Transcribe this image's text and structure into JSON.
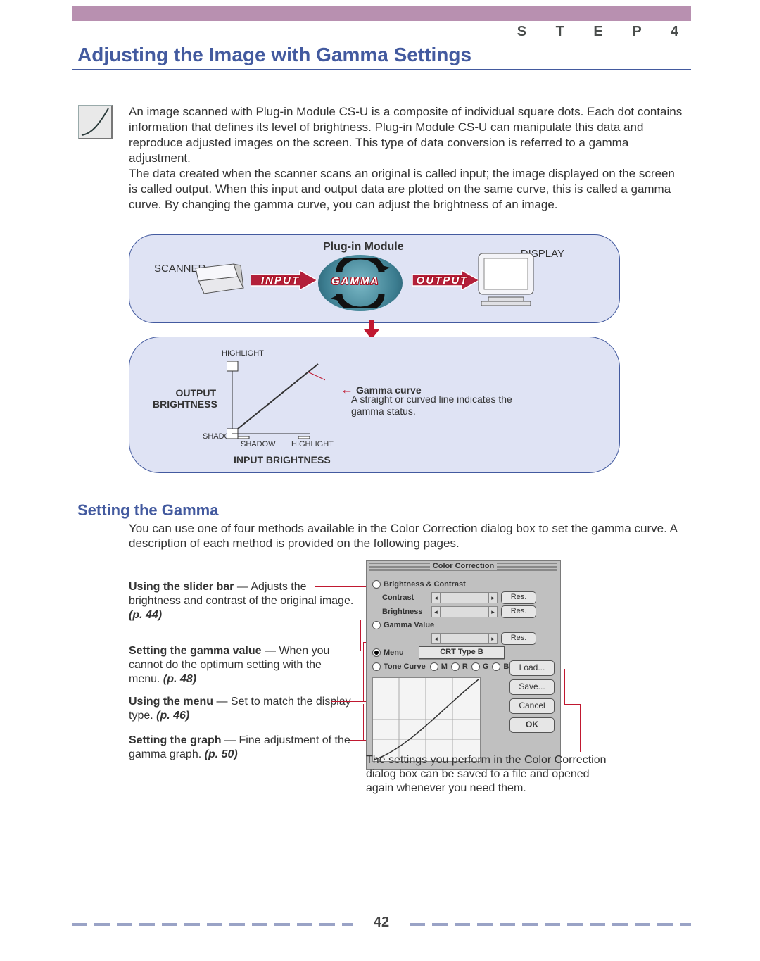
{
  "header": {
    "step": "S T E P   4",
    "title": "Adjusting the Image with Gamma Settings"
  },
  "intro": "An image scanned with Plug-in Module CS-U is a composite of individual square dots. Each dot contains information that defines its level of brightness.  Plug-in Module CS-U can manipulate this data and reproduce adjusted images on the screen.  This type of data conversion is referred to a gamma adjustment.\nThe data created when the scanner scans an original is called input; the image displayed on the screen is called output.  When this input and output data are plotted on the same curve, this is called a gamma curve.  By changing the gamma curve, you can adjust the brightness of an image.",
  "d1": {
    "plugin": "Plug-in Module",
    "scanner": "SCANNER",
    "display": "DISPLAY",
    "input": "INPUT",
    "output": "OUTPUT",
    "gamma": "GAMMA"
  },
  "d2": {
    "outputBrightness": "OUTPUT\nBRIGHTNESS",
    "inputBrightness": "INPUT BRIGHTNESS",
    "highlight": "HIGHLIGHT",
    "shadow": "SHADOW",
    "gammaCurve": "Gamma curve",
    "gammaCurveDesc": "A straight or curved line indicates the gamma status."
  },
  "section2": {
    "heading": "Setting the Gamma",
    "desc": "You can use one of four methods available in the Color Correction dialog box to set the gamma curve. A description of each method is provided on the following pages."
  },
  "methods": {
    "m1": {
      "t": "Using the slider bar",
      "d": " — Adjusts the brightness and contrast of the original image.  ",
      "p": "(p. 44)"
    },
    "m2": {
      "t": "Setting the gamma value",
      "d": " — When you cannot do the optimum setting with the menu.  ",
      "p": "(p. 48)"
    },
    "m3": {
      "t": "Using the menu",
      "d": " — Set to match the display type.  ",
      "p": "(p. 46)"
    },
    "m4": {
      "t": "Setting the graph",
      "d": " — Fine adjustment of the gamma graph.  ",
      "p": "(p. 50)"
    }
  },
  "panel": {
    "title": "Color Correction",
    "bc": "Brightness & Contrast",
    "contrast": "Contrast",
    "brightness": "Brightness",
    "gammaValue": "Gamma Value",
    "menu": "Menu",
    "menuValue": "CRT Type B",
    "toneCurve": "Tone Curve",
    "channels": {
      "m": "M",
      "r": "R",
      "g": "G",
      "b": "B"
    },
    "res": "Res.",
    "btn": {
      "load": "Load...",
      "save": "Save...",
      "cancel": "Cancel",
      "ok": "OK"
    }
  },
  "dialogNote": "The settings you perform in the Color Correction dialog box can be saved to a file and opened again whenever you need them.",
  "chart_data": {
    "type": "line",
    "title": "Gamma curve",
    "xlabel": "INPUT BRIGHTNESS",
    "ylabel": "OUTPUT BRIGHTNESS",
    "xlim": [
      "SHADOW",
      "HIGHLIGHT"
    ],
    "ylim": [
      "SHADOW",
      "HIGHLIGHT"
    ],
    "series": [
      {
        "name": "gamma",
        "x": [
          0,
          1
        ],
        "y": [
          0,
          1
        ]
      }
    ]
  },
  "page": "42"
}
